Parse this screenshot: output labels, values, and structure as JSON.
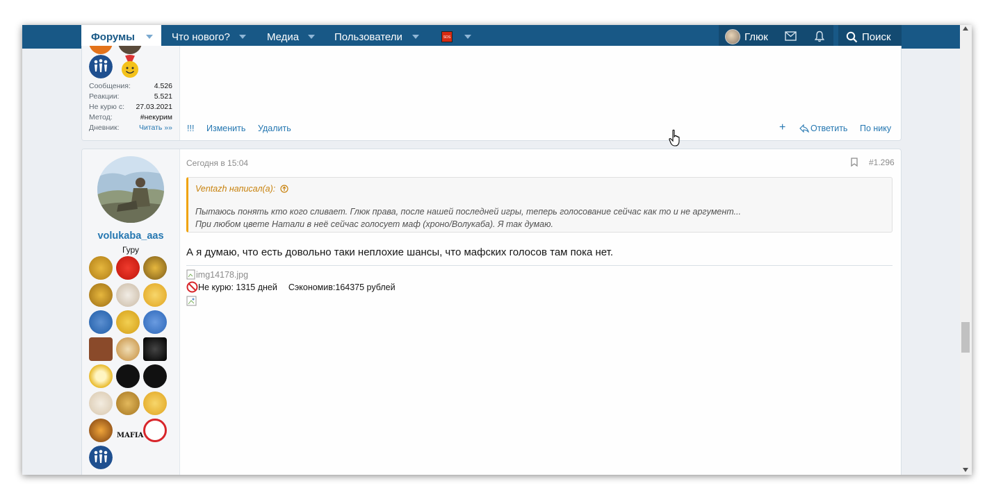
{
  "navbar": {
    "tabs": [
      {
        "label": "Форумы",
        "active": true
      },
      {
        "label": "Что нового?"
      },
      {
        "label": "Медиа"
      },
      {
        "label": "Пользователи"
      },
      {
        "label": "SOS"
      }
    ],
    "user": "Глюк",
    "search": "Поиск"
  },
  "post1": {
    "stats": [
      {
        "k": "Сообщения:",
        "v": "4.526"
      },
      {
        "k": "Реакции:",
        "v": "5.521"
      },
      {
        "k": "Не курю с:",
        "v": "27.03.2021"
      },
      {
        "k": "Метод:",
        "v": "#некурим"
      },
      {
        "k": "Дневник:",
        "v": "Читать »»"
      }
    ],
    "actions": {
      "mark": "!!!",
      "edit": "Изменить",
      "delete": "Удалить",
      "plus": "+",
      "reply": "Ответить",
      "by_nick": "По нику"
    }
  },
  "post2": {
    "username": "volukaba_aas",
    "user_title": "Гуру",
    "time": "Сегодня в 15:04",
    "number": "#1.296",
    "quote_author": "Ventazh написал(а):",
    "quote_line1": "Пытаюсь понять кто кого сливает. Глюк права, после нашей последней игры, теперь голосование сейчас как то и не аргумент...",
    "quote_line2": "При любом цвете Натали в неё сейчас голосует маф (хроно/Волукаба). Я так думаю.",
    "message": "А я думаю, что есть довольно таки неплохие шансы, что мафских голосов там пока нет.",
    "image_alt": "img14178.jpg",
    "not_smoking": "Не курю: 1315 дней",
    "saved": "Сэкономив:164375 рублей"
  },
  "colors": {
    "navbar": "#185886",
    "link": "#2577b1",
    "quote_accent": "#f0a30a"
  }
}
